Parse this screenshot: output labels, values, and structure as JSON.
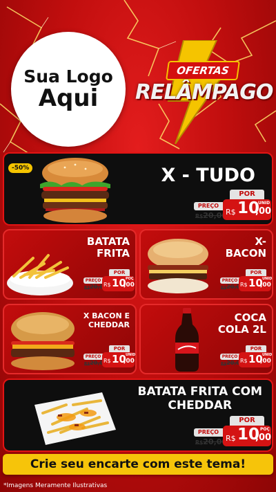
{
  "header": {
    "logo_line1": "Sua Logo",
    "logo_line2": "Aqui",
    "flash_tag": "OFERTAS",
    "flash_title": "RELÂMPAGO"
  },
  "products": [
    {
      "id": "x-tudo",
      "name": "X - TUDO",
      "badge": "-50%",
      "preco_label": "PREÇO",
      "old_price": "20,00",
      "old_currency": "R$",
      "por_label": "POR",
      "currency": "R$",
      "price_int": "10",
      "price_dec": ",00",
      "unit": "UNID"
    },
    {
      "id": "batata-frita",
      "name_line1": "BATATA",
      "name_line2": "FRITA",
      "preco_label": "PREÇO",
      "old_price": "20,00",
      "old_currency": "R$",
      "por_label": "POR",
      "currency": "R$",
      "price_int": "10",
      "price_dec": ",00",
      "unit": "POÇ"
    },
    {
      "id": "x-bacon",
      "name_line1": "X-",
      "name_line2": "BACON",
      "preco_label": "PREÇO",
      "old_price": "20,00",
      "old_currency": "R$",
      "por_label": "POR",
      "currency": "R$",
      "price_int": "10",
      "price_dec": ",00",
      "unit": "UNID"
    },
    {
      "id": "x-bacon-cheddar",
      "name_line1": "X BACON E",
      "name_line2": "CHEDDAR",
      "preco_label": "PREÇO",
      "old_price": "20,00",
      "old_currency": "R$",
      "por_label": "POR",
      "currency": "R$",
      "price_int": "10",
      "price_dec": ",00",
      "unit": "UNID"
    },
    {
      "id": "coca-cola",
      "name_line1": "COCA",
      "name_line2": "COLA 2L",
      "preco_label": "PREÇO",
      "old_price": "20,00",
      "old_currency": "R$",
      "por_label": "POR",
      "currency": "R$",
      "price_int": "10",
      "price_dec": ",00",
      "unit": "UNID"
    },
    {
      "id": "batata-cheddar",
      "name_line1": "BATATA FRITA COM",
      "name_line2": "CHEDDAR",
      "preco_label": "PREÇO",
      "old_price": "20,00",
      "old_currency": "R$",
      "por_label": "POR",
      "currency": "R$",
      "price_int": "10",
      "price_dec": ",00",
      "unit": "POÇ"
    }
  ],
  "cta": "Crie seu encarte com este tema!",
  "footnote": "*Imagens Meramente Ilustrativas",
  "colors": {
    "background": "#c10e0e",
    "accent": "#f5c400",
    "price_red": "#d41313",
    "card_dark": "#0e0e0e"
  }
}
